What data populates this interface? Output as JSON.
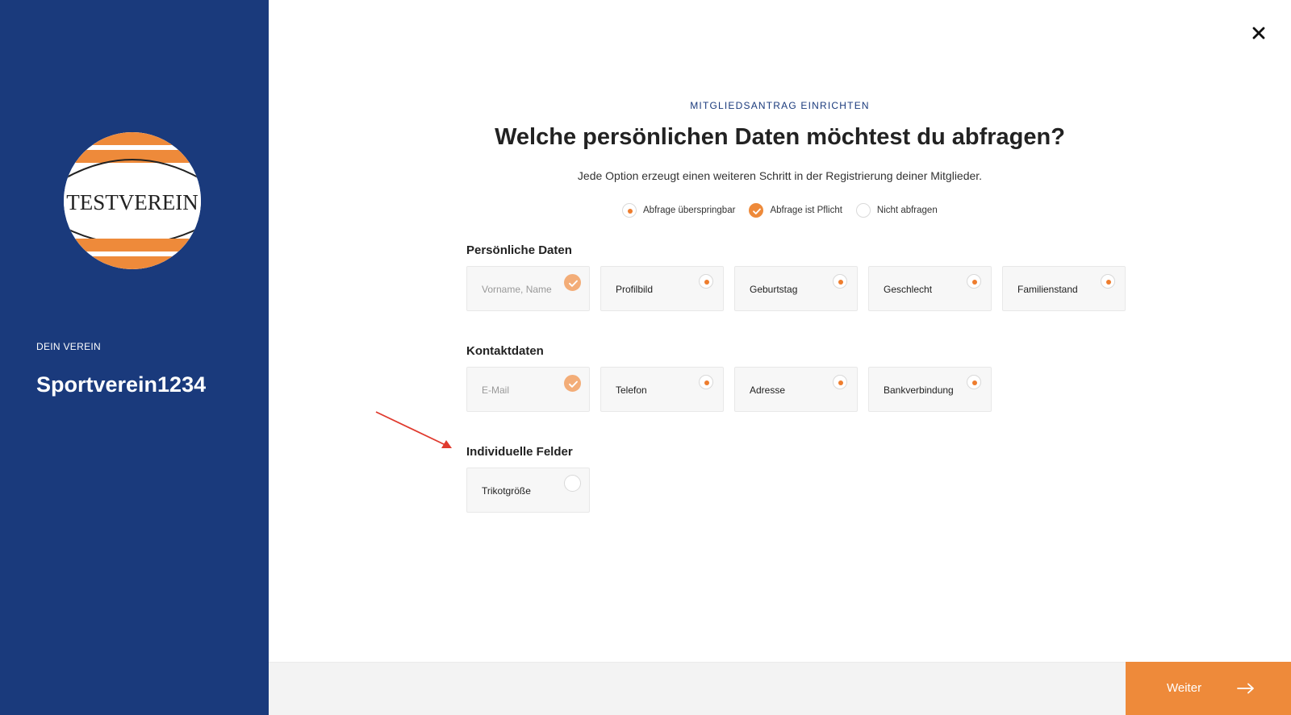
{
  "sidebar": {
    "logo_text": "TESTVEREIN",
    "club_caption": "DEIN VEREIN",
    "club_name": "Sportverein1234"
  },
  "header": {
    "eyebrow": "MITGLIEDSANTRAG EINRICHTEN",
    "title": "Welche persönlichen Daten möchtest du abfragen?",
    "subtitle": "Jede Option erzeugt einen weiteren Schritt in der Registrierung deiner Mitglieder."
  },
  "legend": {
    "optional": "Abfrage überspringbar",
    "required": "Abfrage ist Pflicht",
    "none": "Nicht abfragen"
  },
  "sections": {
    "personal": {
      "title": "Persönliche Daten",
      "fields": [
        "Vorname, Name",
        "Profilbild",
        "Geburtstag",
        "Geschlecht",
        "Familienstand"
      ]
    },
    "contact": {
      "title": "Kontaktdaten",
      "fields": [
        "E-Mail",
        "Telefon",
        "Adresse",
        "Bankverbindung"
      ]
    },
    "custom": {
      "title": "Individuelle Felder",
      "fields": [
        "Trikotgröße"
      ]
    }
  },
  "footer": {
    "next_label": "Weiter"
  },
  "colors": {
    "sidebar": "#1a3a7c",
    "accent": "#ee8a3a",
    "annotation_arrow": "#e03a2e"
  }
}
